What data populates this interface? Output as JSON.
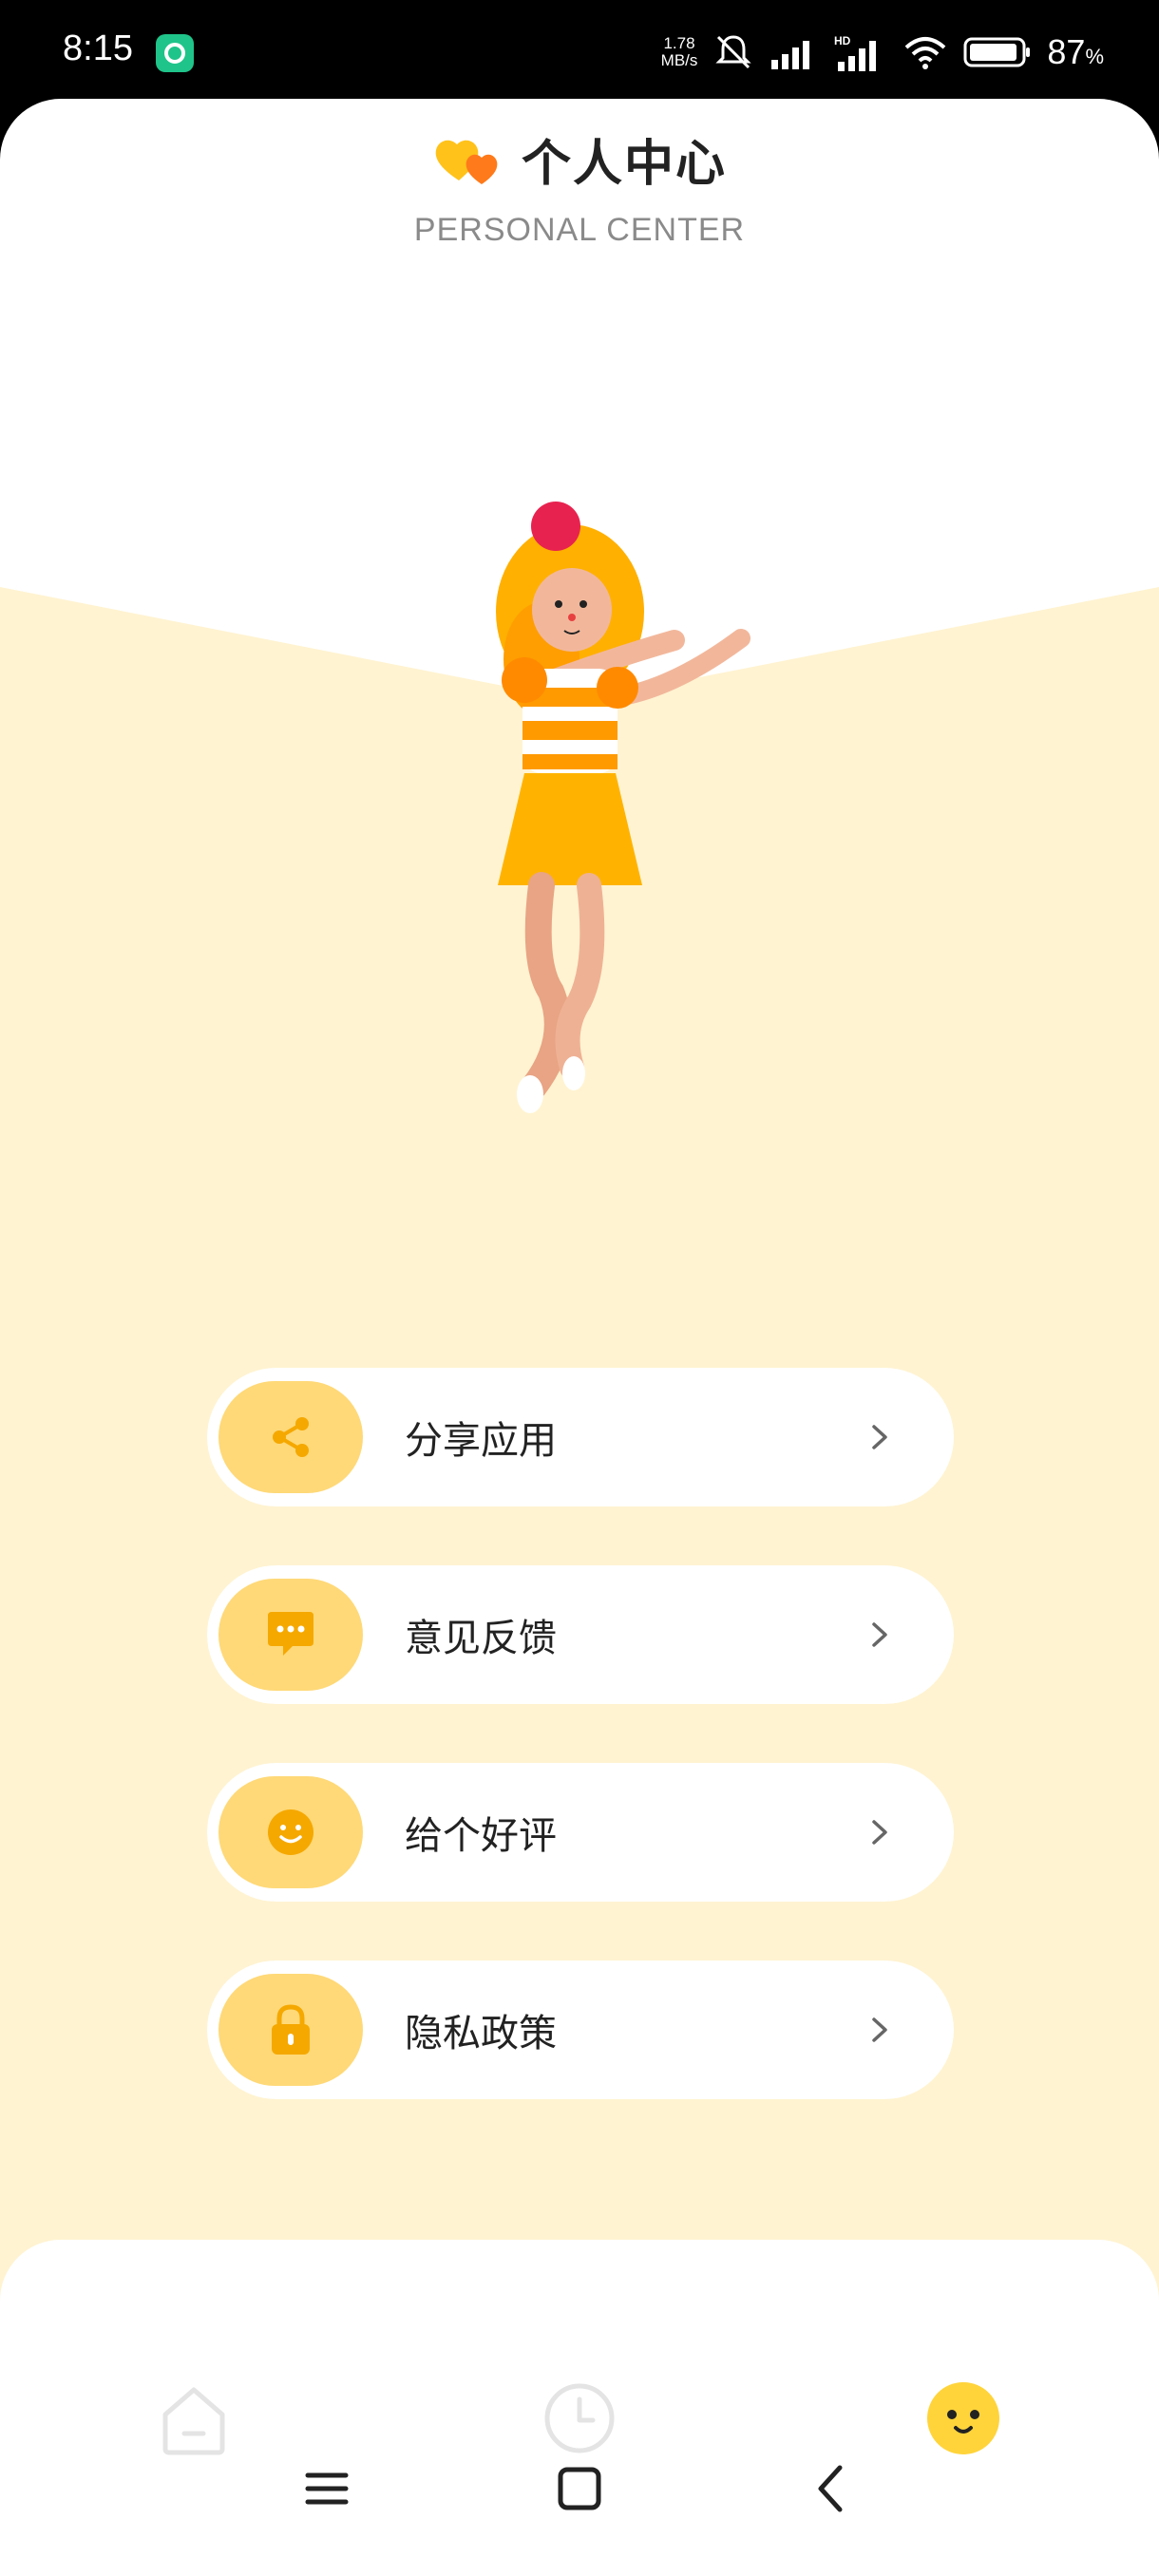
{
  "status_bar": {
    "time": "8:15",
    "speed_value": "1.78",
    "speed_unit": "MB/s",
    "battery_value": "87",
    "battery_unit": "%"
  },
  "header": {
    "title": "个人中心",
    "subtitle": "PERSONAL CENTER"
  },
  "menu": {
    "items": [
      {
        "label": "分享应用",
        "icon": "share-icon"
      },
      {
        "label": "意见反馈",
        "icon": "feedback-icon"
      },
      {
        "label": "给个好评",
        "icon": "smile-icon"
      },
      {
        "label": "隐私政策",
        "icon": "lock-icon"
      }
    ]
  },
  "tabs": [
    {
      "icon": "home-icon",
      "active": false
    },
    {
      "icon": "clock-icon",
      "active": false
    },
    {
      "icon": "smiley-face-icon",
      "active": true
    }
  ],
  "colors": {
    "accent": "#ffbf1f",
    "accent_light": "#ffd978",
    "background_cream": "#fff3d1"
  }
}
